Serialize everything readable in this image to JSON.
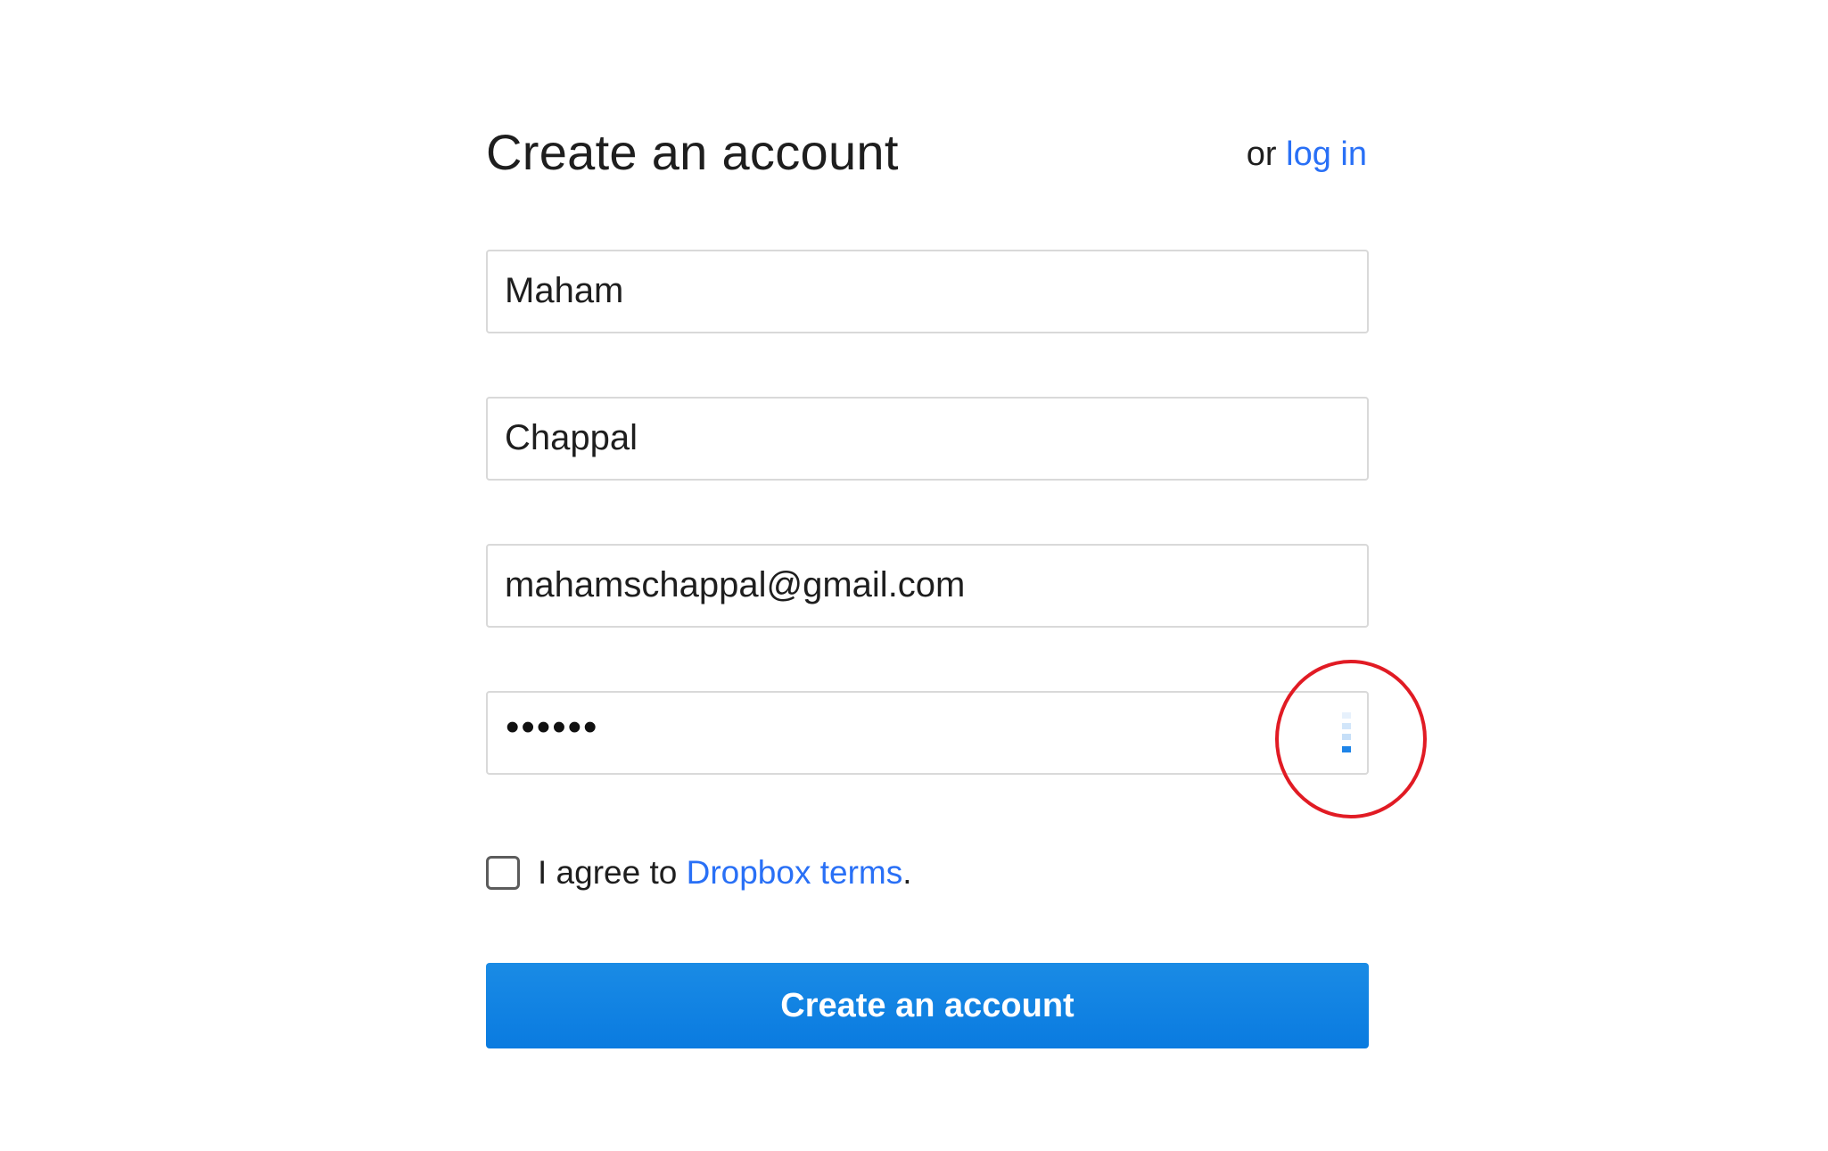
{
  "header": {
    "title": "Create an account",
    "alt_prefix": "or",
    "alt_link": "log in"
  },
  "fields": {
    "first_name": {
      "value": "Maham"
    },
    "last_name": {
      "value": "Chappal"
    },
    "email": {
      "value": "mahamschappal@gmail.com"
    },
    "password": {
      "masked_value": "••••••"
    }
  },
  "terms": {
    "checked": false,
    "prefix": "I agree to ",
    "link": "Dropbox terms",
    "suffix": "."
  },
  "submit": {
    "label": "Create an account"
  },
  "colors": {
    "accent_link": "#2970f6",
    "primary_button": "#0a7be0",
    "annotation_circle": "#e11b24",
    "strength_meter_active": "#1e84e8"
  }
}
